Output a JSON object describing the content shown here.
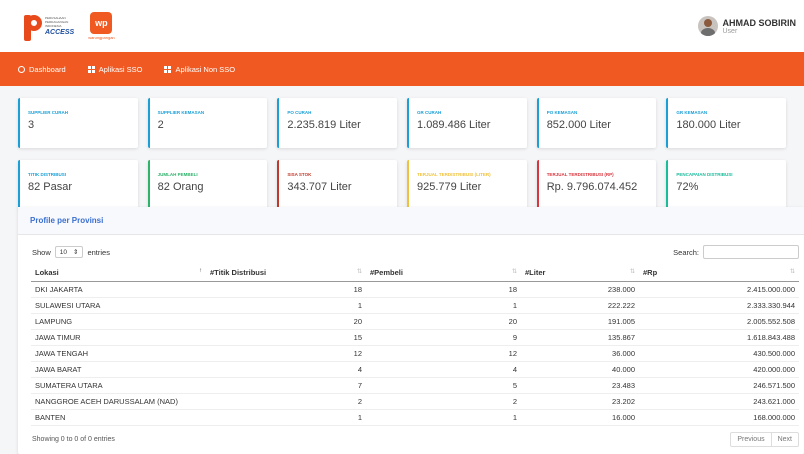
{
  "header": {
    "logo1": {
      "lines": [
        "PERUSAHAAN",
        "PERDAGANGAN",
        "INDONESIA"
      ],
      "access": "ACCESS"
    },
    "logo2": {
      "mark": "wp",
      "caption": "warungpangan"
    },
    "user": {
      "name": "AHMAD SOBIRIN",
      "role": "User"
    }
  },
  "nav": {
    "dashboard": "Dashboard",
    "app_sso": "Aplikasi SSO",
    "app_non_sso": "Aplikasi Non SSO"
  },
  "cards": [
    {
      "label": "SUPPLIER CURAH",
      "value": "3",
      "color": "#1a9fd6"
    },
    {
      "label": "SUPPLIER KEMASAN",
      "value": "2",
      "color": "#1a9fd6"
    },
    {
      "label": "PO CURAH",
      "value": "2.235.819 Liter",
      "color": "#1a9fd6"
    },
    {
      "label": "GR CURAH",
      "value": "1.089.486 Liter",
      "color": "#1a9fd6"
    },
    {
      "label": "PO KEMASAN",
      "value": "852.000 Liter",
      "color": "#1a9fd6"
    },
    {
      "label": "GR KEMASAN",
      "value": "180.000 Liter",
      "color": "#1a9fd6"
    },
    {
      "label": "TITIK DISTRIBUSI",
      "value": "82 Pasar",
      "color": "#1a9fd6"
    },
    {
      "label": "JUMLAH PEMBELI",
      "value": "82 Orang",
      "color": "#2fb36b"
    },
    {
      "label": "SISA STOK",
      "value": "343.707 Liter",
      "color": "#c0392b"
    },
    {
      "label": "TERJUAL TERDISTRIBUSI (LITER)",
      "value": "925.779 Liter",
      "color": "#f0c23c"
    },
    {
      "label": "TERJUAL TERDISTRIBUSI (RP)",
      "value": "Rp. 9.796.074.452",
      "color": "#d9363e"
    },
    {
      "label": "PENCAPAIAN DISTRIBUSI",
      "value": "72%",
      "color": "#1abc9c"
    }
  ],
  "panel": {
    "title": "Profile per Provinsi",
    "show_label": "Show",
    "entries_value": "10",
    "entries_label": "entries",
    "search_label": "Search:",
    "search_value": "",
    "columns": [
      "Lokasi",
      "#Titik Distribusi",
      "#Pembeli",
      "#Liter",
      "#Rp"
    ],
    "rows": [
      [
        "DKI JAKARTA",
        "18",
        "18",
        "238.000",
        "2.415.000.000"
      ],
      [
        "SULAWESI UTARA",
        "1",
        "1",
        "222.222",
        "2.333.330.944"
      ],
      [
        "LAMPUNG",
        "20",
        "20",
        "191.005",
        "2.005.552.508"
      ],
      [
        "JAWA TIMUR",
        "15",
        "9",
        "135.867",
        "1.618.843.488"
      ],
      [
        "JAWA TENGAH",
        "12",
        "12",
        "36.000",
        "430.500.000"
      ],
      [
        "JAWA BARAT",
        "4",
        "4",
        "40.000",
        "420.000.000"
      ],
      [
        "SUMATERA UTARA",
        "7",
        "5",
        "23.483",
        "246.571.500"
      ],
      [
        "NANGGROE ACEH DARUSSALAM (NAD)",
        "2",
        "2",
        "23.202",
        "243.621.000"
      ],
      [
        "BANTEN",
        "1",
        "1",
        "16.000",
        "168.000.000"
      ]
    ],
    "info": "Showing 0 to 0 of 0 entries",
    "prev": "Previous",
    "next": "Next"
  }
}
